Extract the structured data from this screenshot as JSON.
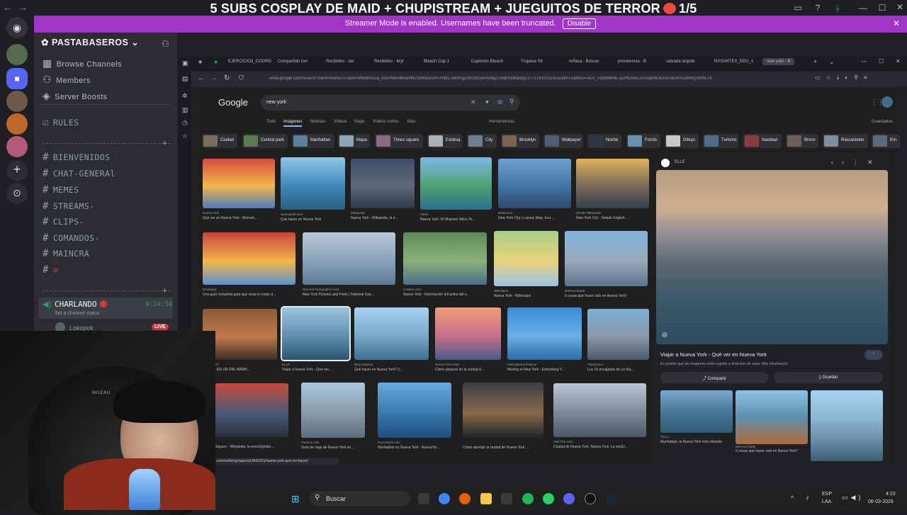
{
  "window": {
    "title": "5 SUBS COSPLAY DE MAID + CHUPISTREAM + JUEGUITOS DE TERROR",
    "episode": "1/5",
    "emoji_icon": "devil-face-icon"
  },
  "banner": {
    "text": "Streamer Mode is enabled. Usernames have been truncated.",
    "button": "Disable"
  },
  "server": {
    "name": "PASTABASEROS",
    "items": [
      {
        "label": "Browse Channels",
        "icon": "compass-icon"
      },
      {
        "label": "Members",
        "icon": "members-icon"
      },
      {
        "label": "Server Boosts",
        "icon": "boost-icon"
      }
    ],
    "rules": "RULES",
    "channels": [
      "BIENVENIDOS",
      "CHAT-GENERAl",
      "MEMES",
      "STREAMS-",
      "CLIPS-",
      "COMANDOS-",
      "MAINCRA",
      ""
    ],
    "voice_channel": "CHARLANDO",
    "voice_time": "4:24:34",
    "voice_status": "Set a channel status",
    "voice_user": "Lokopok",
    "live_badge": "LIVE"
  },
  "browser": {
    "tabs": [
      "EJERCICIO3_COORD",
      "Compartido con",
      "Recibidos - tav",
      "Recibidos - bryt",
      "Bleach Cap 1",
      "Capitulos Bleach",
      "Trupasa Str",
      "reñaca - Buscar",
      "providencia - B",
      "calzada arquite",
      "RASANTES_DDU_1",
      "new york - B"
    ],
    "url": "www.google.com/search?client=firefox-b-d&hl=MW890sca_esv=f9e0460a4f42180f&sxsrf=ANbL-n60mgoVA29OykPpNqZU8qhVkWaxpg:1772781021141&udm=2&bfoo=ADc_l-bpk8W4E-qsVfOvbGJcOwpm60DcsFdcxPnuv8WQoWhLTb",
    "status_url": "com/es/living/viajes/a19452201/nueva-york-que-ver-hacer/"
  },
  "google": {
    "logo": "Google",
    "query": "new york",
    "tabs": [
      "Todo",
      "Imágenes",
      "Noticias",
      "Vídeos",
      "Maps",
      "Vídeos cortos",
      "Más"
    ],
    "tools": "Herramientas",
    "saved": "Guardados",
    "chips": [
      "Ciudad",
      "Central park",
      "Manhattan",
      "Mapa",
      "Times square",
      "Estatua",
      "City",
      "Brooklyn",
      "Wallpaper",
      "Noche",
      "Fondo",
      "Dibujo",
      "Turismo",
      "Navidad",
      "Bronx",
      "Rascacielos",
      "Em"
    ],
    "results": [
      {
        "src": "Nueva York",
        "cap": "Qué ver en Nueva York - Monum..."
      },
      {
        "src": "Nuevayork.com",
        "cap": "Qué hacer en Nueva York"
      },
      {
        "src": "Wikipedia",
        "cap": "Nueva York - Wikipedia, la e..."
      },
      {
        "src": "Viator",
        "cap": "Nueva York: 30 Mejores Sitios To..."
      },
      {
        "src": "Britannica",
        "cap": "New York City | Layout, Map, Eco..."
      },
      {
        "src": "Simple Wikipedia",
        "cap": "New York City - Simple English ..."
      },
      {
        "src": "Despegar",
        "cap": "Una guía completa para que vivas lo mejor d..."
      },
      {
        "src": "National Geographic Kids",
        "cap": "New York Pictures and Facts | National Geo..."
      },
      {
        "src": "Hotwire.com",
        "cap": "Nueva York - Información útil antes del v..."
      },
      {
        "src": "Wikiviajes",
        "cap": "Nueva York - Wikiviajes"
      },
      {
        "src": "GetYourGuide",
        "cap": "5 cosas que hacer solo en Nueva York?"
      },
      {
        "src": "Travel NYC",
        "cap": "A YORK EN UN DÍA: MANH..."
      },
      {
        "src": "ELLE",
        "cap": "Viajar a Nueva York - Qué ver..."
      },
      {
        "src": "Blog Viajeros",
        "cap": "Qué hacer en Nueva York? 2..."
      },
      {
        "src": "Nueva York Pass",
        "cap": "Cómo alojarse en la ciudad d..."
      },
      {
        "src": "International Rescue",
        "cap": "Moving to New York - Everything Y..."
      },
      {
        "src": "Tripadvisor",
        "cap": "Los 15 encajadas de un día..."
      },
      {
        "src": "",
        "cap": "Square - Wikipedia, la enciclopedia ..."
      },
      {
        "src": "Turismo ruta",
        "cap": "Guía de viaje de Nueva York en ..."
      },
      {
        "src": "NuevaYork.com",
        "cap": "Manhattan en Nueva York - NuevaYor..."
      },
      {
        "src": "",
        "cap": "Cómo abordar la ciudad de Nueva York ..."
      },
      {
        "src": "Visit The USA",
        "cap": "Ciudad de Nueva York, Nueva York. La encicl..."
      }
    ],
    "panel": {
      "source": "ELLE",
      "title": "Viajar a Nueva York - Qué ver en Nueva York",
      "note": "Es posible que las imágenes estén sujetas a derechos de autor. Más información",
      "share": "Compartir",
      "save": "Guardar",
      "related": [
        {
          "src": "HOLA",
          "cap": "Manhattan, la Nueva York más vibrante"
        },
        {
          "src": "GetYourGuide",
          "cap": "5 cosas que hacer solo en Nueva York?"
        }
      ]
    }
  },
  "taskbar": {
    "search": "Buscar",
    "lang": "ESP",
    "lang2": "LAA",
    "time": "4:10",
    "date": "06-03-2026"
  },
  "webcam_text": "MUZAU",
  "colors": {
    "banner": "#a234c9",
    "accent": "#8ab4f8",
    "live": "#da373c",
    "discord": "#2b2d31"
  }
}
